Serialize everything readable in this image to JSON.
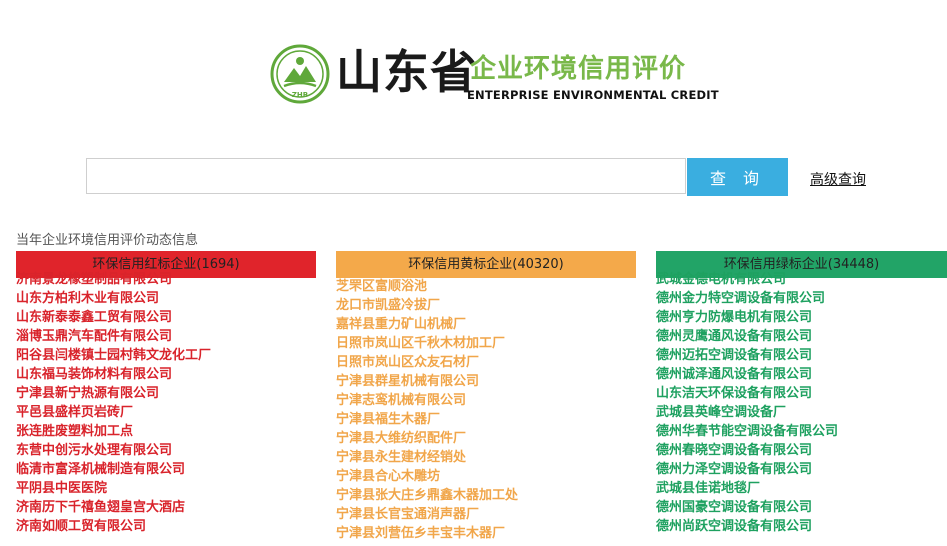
{
  "header": {
    "title_cn": "山东省",
    "subtitle_cn": "企业环境信用评价",
    "subtitle_en": "ENTERPRISE ENVIRONMENTAL CREDIT",
    "emblem_text": "ZHB"
  },
  "search": {
    "placeholder": "",
    "value": "",
    "button_label": "查 询",
    "advanced_link": "高级查询"
  },
  "dynamic_info_title": "当年企业环境信用评价动态信息",
  "colors": {
    "red": "#e0242b",
    "yellow": "#f4a94a",
    "green": "#22a467",
    "search_blue": "#3aaee0"
  },
  "columns": {
    "red": {
      "header": "环保信用红标企业(1694)",
      "items": [
        "济南景龙橡塑制品有限公司",
        "山东方柏利木业有限公司",
        "山东新泰泰鑫工贸有限公司",
        "淄博玉鼎汽车配件有限公司",
        "阳谷县闫楼镇士园村韩文龙化工厂",
        "山东福马装饰材料有限公司",
        "宁津县新宁热源有限公司",
        "平邑县盛样页岩砖厂",
        "张连胜废塑料加工点",
        "东营中创污水处理有限公司",
        "临清市富泽机械制造有限公司",
        "平阴县中医医院",
        "济南历下千禧鱼翅皇宫大酒店",
        "济南如顺工贸有限公司"
      ]
    },
    "yellow": {
      "header": "环保信用黄标企业(40320)",
      "items": [
        "芝罘区富顺浴池",
        "龙口市凯盛冷拔厂",
        "嘉祥县重力矿山机械厂",
        "日照市岚山区千秋木材加工厂",
        "日照市岚山区众友石材厂",
        "宁津县群星机械有限公司",
        "宁津志鸾机械有限公司",
        "宁津县福生木器厂",
        "宁津县大维纺织配件厂",
        "宁津县永生建材经销处",
        "宁津县合心木雕坊",
        "宁津县张大庄乡鼎鑫木器加工处",
        "宁津县长官宝通消声器厂",
        "宁津县刘营伍乡丰宝丰木器厂"
      ]
    },
    "green": {
      "header": "环保信用绿标企业(34448)",
      "items": [
        "武城金德电机有限公司",
        "德州金力特空调设备有限公司",
        "德州亨力防爆电机有限公司",
        "德州灵鹰通风设备有限公司",
        "德州迈拓空调设备有限公司",
        "德州诚泽通风设备有限公司",
        "山东洁天环保设备有限公司",
        "武城县英峰空调设备厂",
        "德州华春节能空调设备有限公司",
        "德州春晓空调设备有限公司",
        "德州力泽空调设备有限公司",
        "武城县佳诺地毯厂",
        "德州国豪空调设备有限公司",
        "德州尚跃空调设备有限公司"
      ]
    }
  }
}
